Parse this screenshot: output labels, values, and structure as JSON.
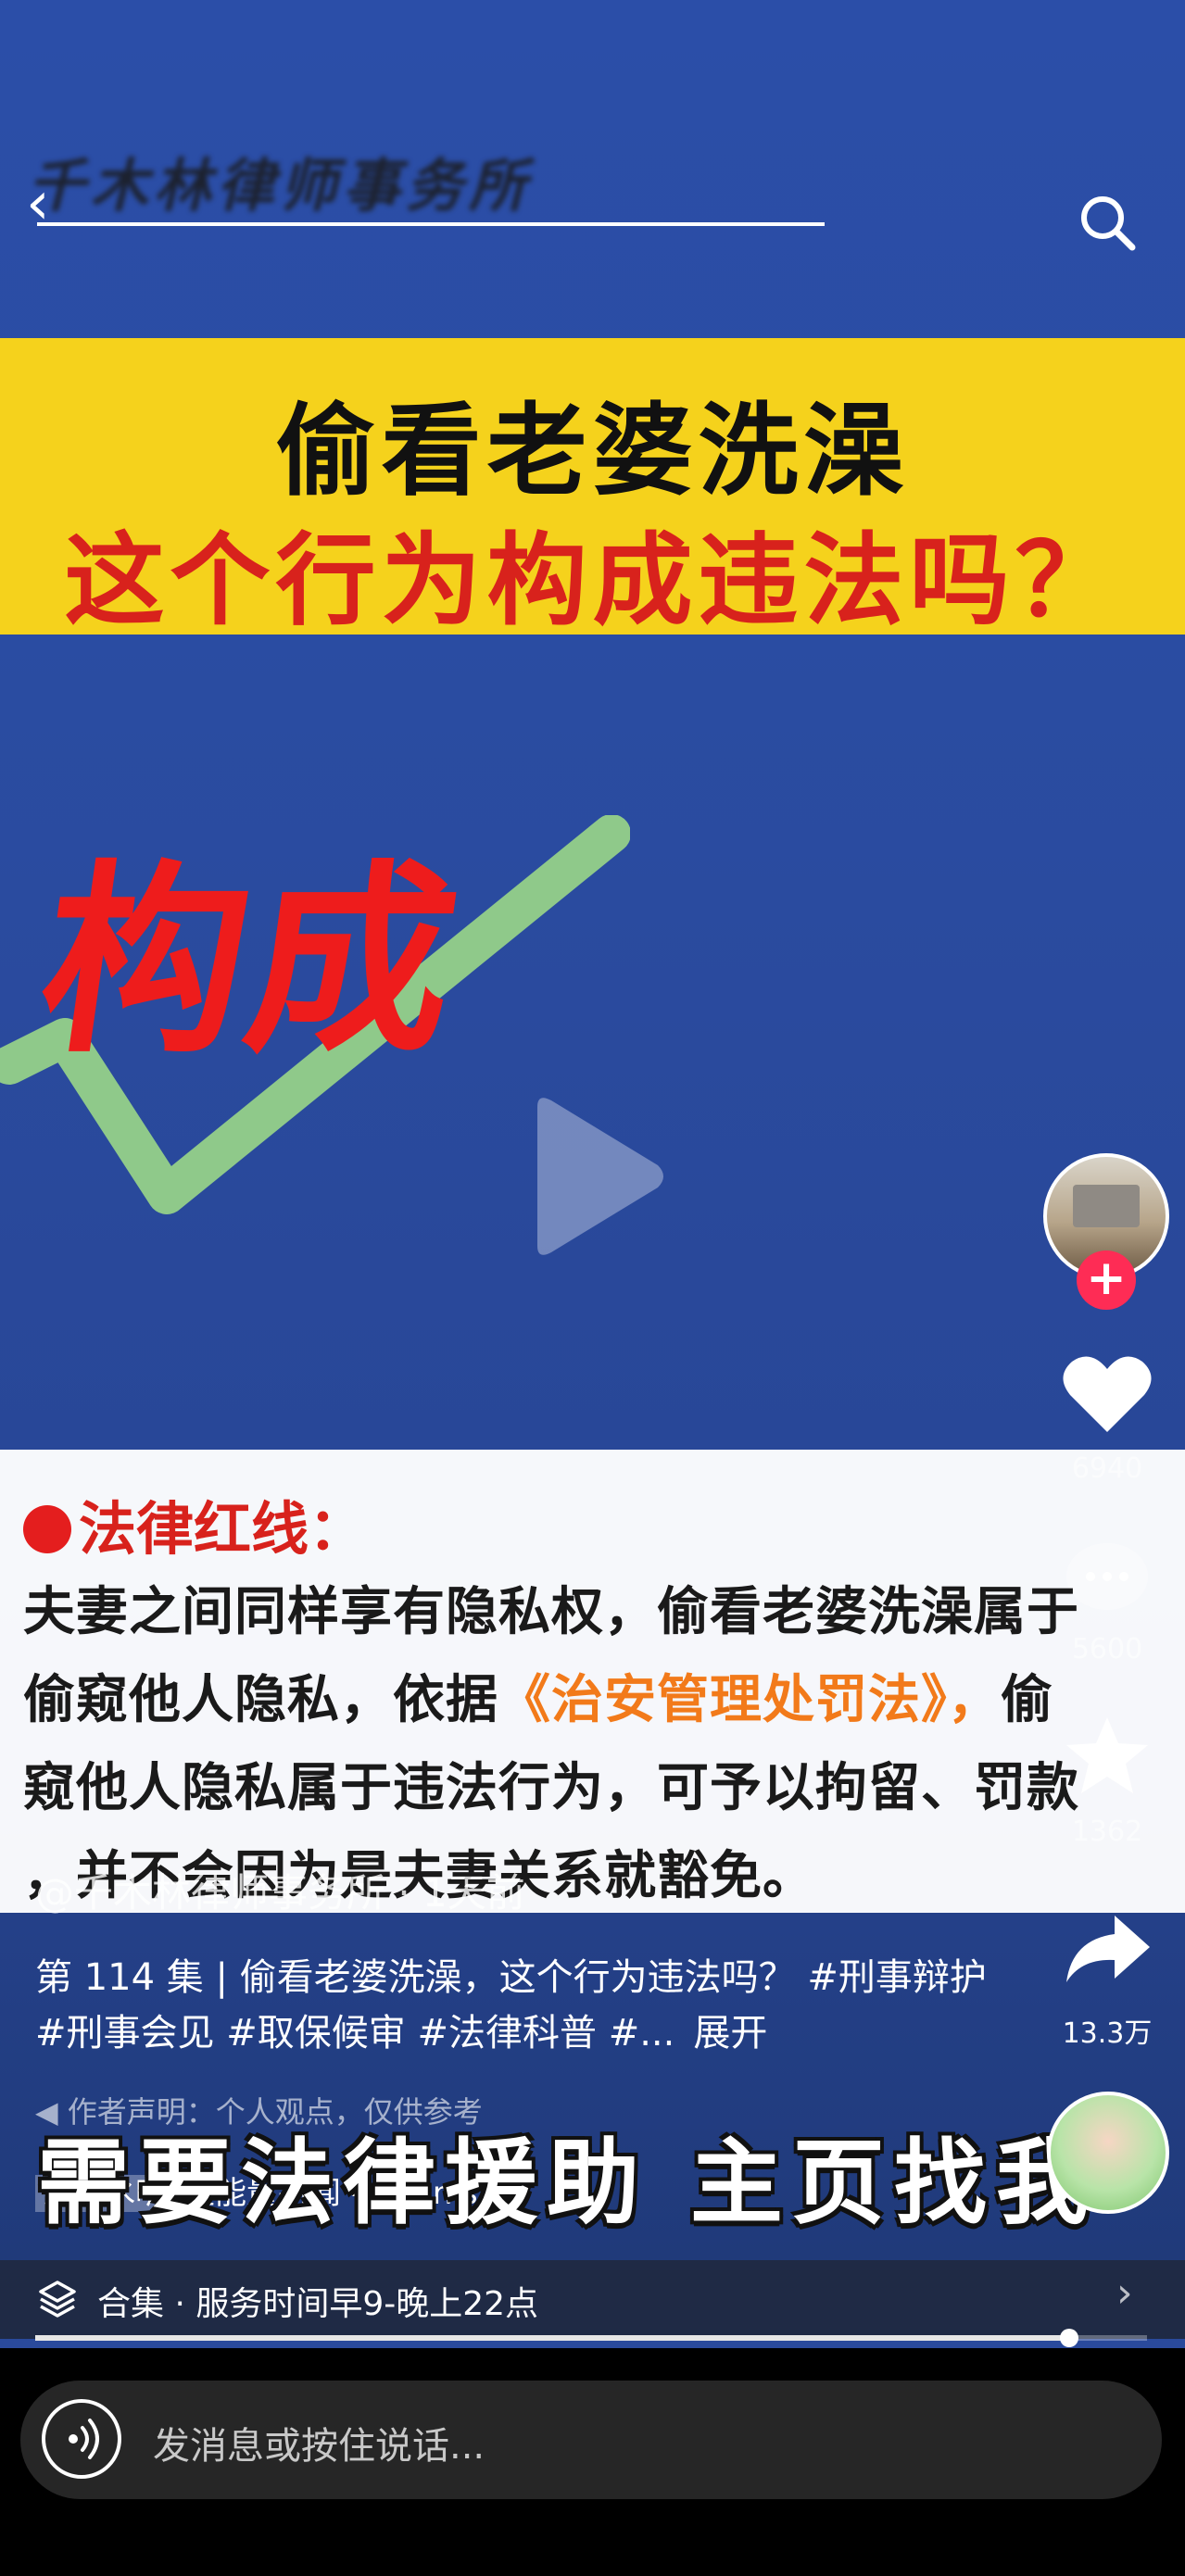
{
  "header": {
    "title": "千木林律师事务所",
    "back_glyph": "‹",
    "search_icon": "search-icon"
  },
  "banner": {
    "line1": "偷看老婆洗澡",
    "line2": "这个行为构成违法吗？",
    "bg_color": "#f5d21c"
  },
  "video": {
    "big_word": "构成",
    "check_icon": "checkmark-icon",
    "play_icon": "play-icon"
  },
  "sidebar": {
    "follow_glyph": "+",
    "like_count": "6940",
    "comment_count": "5600",
    "favorite_count": "1362",
    "share_count": "13.3万"
  },
  "legal": {
    "title": "法律红线：",
    "line1": "夫妻之间同样享有隐私权，偷看老婆洗澡属于",
    "line2_pre": "偷窥他人隐私，依据",
    "line2_law": "《治安管理处罚法》，",
    "line2_post": "偷",
    "line3": "窥他人隐私属于违法行为，可予以拘留、罚款",
    "line4": "，并不会因为是夫妻关系就豁免。"
  },
  "post": {
    "author": "@千木林律师事务所 · 1天前",
    "caption": "第 114 集 | 偷看老婆洗澡，这个行为违法吗？ #刑事辩护 #刑事会见 #取保候审 #法律科普 #...",
    "expand": "展开",
    "disclaimer": "作者声明：个人观点，仅供参考",
    "overlay": "需要法律援助 主页找我",
    "music_tag": "去汽水听",
    "music": "正能量新闻 - Adonis"
  },
  "playlist": {
    "label": "合集 · 服务时间早9-晚上22点",
    "progress": 0.93
  },
  "input": {
    "placeholder": "发消息或按住说话..."
  },
  "colors": {
    "accent_red": "#d8221c",
    "like_red": "#fe2c55",
    "law_orange": "#f27a1a"
  }
}
